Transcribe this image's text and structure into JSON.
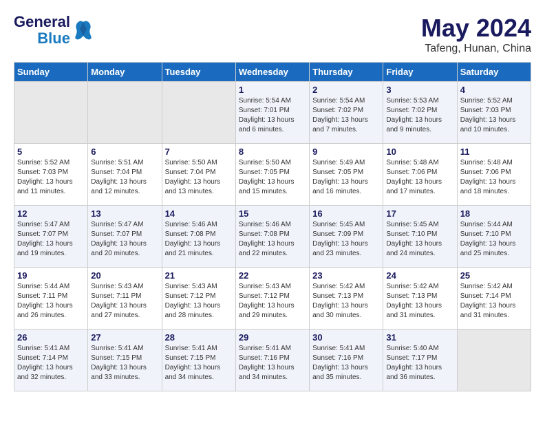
{
  "header": {
    "logo_line1": "General",
    "logo_line2": "Blue",
    "month": "May 2024",
    "location": "Tafeng, Hunan, China"
  },
  "days_of_week": [
    "Sunday",
    "Monday",
    "Tuesday",
    "Wednesday",
    "Thursday",
    "Friday",
    "Saturday"
  ],
  "weeks": [
    [
      {
        "day": "",
        "info": ""
      },
      {
        "day": "",
        "info": ""
      },
      {
        "day": "",
        "info": ""
      },
      {
        "day": "1",
        "info": "Sunrise: 5:54 AM\nSunset: 7:01 PM\nDaylight: 13 hours and 6 minutes."
      },
      {
        "day": "2",
        "info": "Sunrise: 5:54 AM\nSunset: 7:02 PM\nDaylight: 13 hours and 7 minutes."
      },
      {
        "day": "3",
        "info": "Sunrise: 5:53 AM\nSunset: 7:02 PM\nDaylight: 13 hours and 9 minutes."
      },
      {
        "day": "4",
        "info": "Sunrise: 5:52 AM\nSunset: 7:03 PM\nDaylight: 13 hours and 10 minutes."
      }
    ],
    [
      {
        "day": "5",
        "info": "Sunrise: 5:52 AM\nSunset: 7:03 PM\nDaylight: 13 hours and 11 minutes."
      },
      {
        "day": "6",
        "info": "Sunrise: 5:51 AM\nSunset: 7:04 PM\nDaylight: 13 hours and 12 minutes."
      },
      {
        "day": "7",
        "info": "Sunrise: 5:50 AM\nSunset: 7:04 PM\nDaylight: 13 hours and 13 minutes."
      },
      {
        "day": "8",
        "info": "Sunrise: 5:50 AM\nSunset: 7:05 PM\nDaylight: 13 hours and 15 minutes."
      },
      {
        "day": "9",
        "info": "Sunrise: 5:49 AM\nSunset: 7:05 PM\nDaylight: 13 hours and 16 minutes."
      },
      {
        "day": "10",
        "info": "Sunrise: 5:48 AM\nSunset: 7:06 PM\nDaylight: 13 hours and 17 minutes."
      },
      {
        "day": "11",
        "info": "Sunrise: 5:48 AM\nSunset: 7:06 PM\nDaylight: 13 hours and 18 minutes."
      }
    ],
    [
      {
        "day": "12",
        "info": "Sunrise: 5:47 AM\nSunset: 7:07 PM\nDaylight: 13 hours and 19 minutes."
      },
      {
        "day": "13",
        "info": "Sunrise: 5:47 AM\nSunset: 7:07 PM\nDaylight: 13 hours and 20 minutes."
      },
      {
        "day": "14",
        "info": "Sunrise: 5:46 AM\nSunset: 7:08 PM\nDaylight: 13 hours and 21 minutes."
      },
      {
        "day": "15",
        "info": "Sunrise: 5:46 AM\nSunset: 7:08 PM\nDaylight: 13 hours and 22 minutes."
      },
      {
        "day": "16",
        "info": "Sunrise: 5:45 AM\nSunset: 7:09 PM\nDaylight: 13 hours and 23 minutes."
      },
      {
        "day": "17",
        "info": "Sunrise: 5:45 AM\nSunset: 7:10 PM\nDaylight: 13 hours and 24 minutes."
      },
      {
        "day": "18",
        "info": "Sunrise: 5:44 AM\nSunset: 7:10 PM\nDaylight: 13 hours and 25 minutes."
      }
    ],
    [
      {
        "day": "19",
        "info": "Sunrise: 5:44 AM\nSunset: 7:11 PM\nDaylight: 13 hours and 26 minutes."
      },
      {
        "day": "20",
        "info": "Sunrise: 5:43 AM\nSunset: 7:11 PM\nDaylight: 13 hours and 27 minutes."
      },
      {
        "day": "21",
        "info": "Sunrise: 5:43 AM\nSunset: 7:12 PM\nDaylight: 13 hours and 28 minutes."
      },
      {
        "day": "22",
        "info": "Sunrise: 5:43 AM\nSunset: 7:12 PM\nDaylight: 13 hours and 29 minutes."
      },
      {
        "day": "23",
        "info": "Sunrise: 5:42 AM\nSunset: 7:13 PM\nDaylight: 13 hours and 30 minutes."
      },
      {
        "day": "24",
        "info": "Sunrise: 5:42 AM\nSunset: 7:13 PM\nDaylight: 13 hours and 31 minutes."
      },
      {
        "day": "25",
        "info": "Sunrise: 5:42 AM\nSunset: 7:14 PM\nDaylight: 13 hours and 31 minutes."
      }
    ],
    [
      {
        "day": "26",
        "info": "Sunrise: 5:41 AM\nSunset: 7:14 PM\nDaylight: 13 hours and 32 minutes."
      },
      {
        "day": "27",
        "info": "Sunrise: 5:41 AM\nSunset: 7:15 PM\nDaylight: 13 hours and 33 minutes."
      },
      {
        "day": "28",
        "info": "Sunrise: 5:41 AM\nSunset: 7:15 PM\nDaylight: 13 hours and 34 minutes."
      },
      {
        "day": "29",
        "info": "Sunrise: 5:41 AM\nSunset: 7:16 PM\nDaylight: 13 hours and 34 minutes."
      },
      {
        "day": "30",
        "info": "Sunrise: 5:41 AM\nSunset: 7:16 PM\nDaylight: 13 hours and 35 minutes."
      },
      {
        "day": "31",
        "info": "Sunrise: 5:40 AM\nSunset: 7:17 PM\nDaylight: 13 hours and 36 minutes."
      },
      {
        "day": "",
        "info": ""
      }
    ]
  ]
}
